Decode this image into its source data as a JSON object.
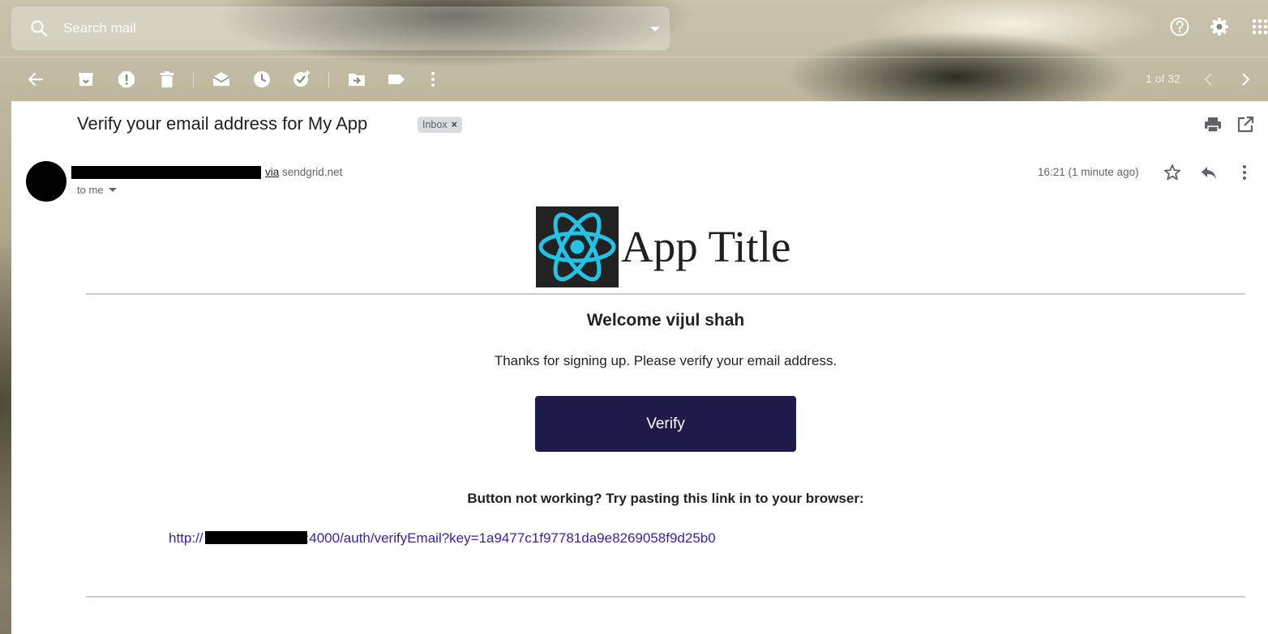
{
  "search": {
    "placeholder": "Search mail"
  },
  "toolbar": {
    "pager": "1 of 32"
  },
  "message": {
    "subject": "Verify your email address for My App",
    "label": "Inbox",
    "label_close": "×",
    "via_word": "via",
    "via_domain": "sendgrid.net",
    "recipient": "to me",
    "time": "16:21 (1 minute ago)"
  },
  "email": {
    "app_title": "App Title",
    "welcome": "Welcome vijul shah",
    "thanks": "Thanks for signing up. Please verify your email address.",
    "button_label": "Verify",
    "fallback_text": "Button not working? Try pasting this link in to your browser:",
    "link_prefix": "http://",
    "link_suffix": ":4000/auth/verifyEmail?key=1a9477c1f97781da9e8269058f9d25b0"
  },
  "colors": {
    "verify_button": "#1e1b4b",
    "link": "#3c1ea5",
    "react_logo": "#22c3e6"
  },
  "icons": [
    "search-icon",
    "dropdown-arrow-icon",
    "help-icon",
    "settings-icon",
    "apps-grid-icon",
    "back-arrow-icon",
    "archive-icon",
    "report-spam-icon",
    "delete-icon",
    "mark-unread-icon",
    "snooze-icon",
    "add-task-icon",
    "move-to-icon",
    "label-icon",
    "more-vert-icon",
    "prev-chevron-icon",
    "next-chevron-icon",
    "print-icon",
    "open-new-window-icon",
    "star-icon",
    "reply-icon",
    "react-logo-icon"
  ]
}
